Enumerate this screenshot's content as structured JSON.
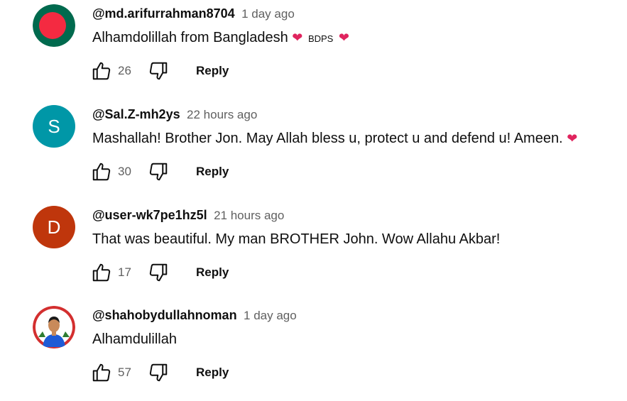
{
  "comments": [
    {
      "author": "@md.arifurrahman8704",
      "time": "1 day ago",
      "text": "Alhamdolillah from Bangladesh",
      "heart": "❤",
      "badge": "BDPS",
      "likes": "26",
      "reply": "Reply",
      "avatar": {
        "type": "flag-bangladesh",
        "colors": {
          "field": "#006a4e",
          "disc": "#f42a41"
        }
      }
    },
    {
      "author": "@Sal.Z-mh2ys",
      "time": "22 hours ago",
      "text": "Mashallah! Brother Jon. May Allah bless u, protect u and defend u! Ameen.",
      "heart": "❤",
      "likes": "30",
      "reply": "Reply",
      "avatar": {
        "type": "letter",
        "letter": "S",
        "color": "#0097a7"
      }
    },
    {
      "author": "@user-wk7pe1hz5l",
      "time": "21 hours ago",
      "text": "That was beautiful. My man BROTHER John. Wow Allahu Akbar!",
      "likes": "17",
      "reply": "Reply",
      "avatar": {
        "type": "letter",
        "letter": "D",
        "color": "#bf360c"
      }
    },
    {
      "author": "@shahobydullahnoman",
      "time": "1 day ago",
      "text": "Alhamdulillah",
      "likes": "57",
      "reply": "Reply",
      "avatar": {
        "type": "photo-person",
        "colors": {
          "ring": "#d32f2f",
          "shirt": "#1e5bd6"
        }
      }
    }
  ],
  "colors": {
    "heart": "#e0245e",
    "secondary_text": "#606060"
  },
  "icons": {
    "like": "thumbs-up-icon",
    "dislike": "thumbs-down-icon"
  }
}
